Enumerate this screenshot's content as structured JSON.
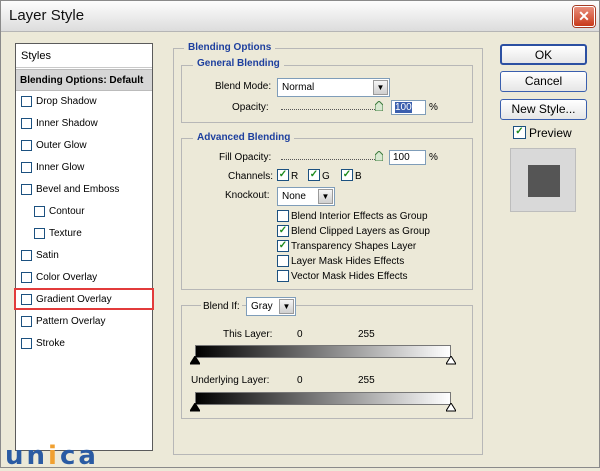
{
  "window": {
    "title": "Layer Style",
    "close_glyph": "✕"
  },
  "styles_panel": {
    "header": "Styles",
    "items": [
      {
        "label": "Blending Options: Default",
        "selected": true,
        "checkbox": false
      },
      {
        "label": "Drop Shadow",
        "checked": false
      },
      {
        "label": "Inner Shadow",
        "checked": false
      },
      {
        "label": "Outer Glow",
        "checked": false
      },
      {
        "label": "Inner Glow",
        "checked": false
      },
      {
        "label": "Bevel and Emboss",
        "checked": false
      },
      {
        "label": "Contour",
        "checked": false,
        "indent": true
      },
      {
        "label": "Texture",
        "checked": false,
        "indent": true
      },
      {
        "label": "Satin",
        "checked": false
      },
      {
        "label": "Color Overlay",
        "checked": false
      },
      {
        "label": "Gradient Overlay",
        "checked": false,
        "highlighted": true
      },
      {
        "label": "Pattern Overlay",
        "checked": false
      },
      {
        "label": "Stroke",
        "checked": false
      }
    ]
  },
  "blending_options": {
    "title": "Blending Options",
    "general": {
      "title": "General Blending",
      "blend_mode_label": "Blend Mode:",
      "blend_mode_value": "Normal",
      "opacity_label": "Opacity:",
      "opacity_value": "100",
      "opacity_unit": "%"
    },
    "advanced": {
      "title": "Advanced Blending",
      "fill_opacity_label": "Fill Opacity:",
      "fill_opacity_value": "100",
      "fill_opacity_unit": "%",
      "channels_label": "Channels:",
      "channels": [
        {
          "label": "R",
          "checked": true
        },
        {
          "label": "G",
          "checked": true
        },
        {
          "label": "B",
          "checked": true
        }
      ],
      "knockout_label": "Knockout:",
      "knockout_value": "None",
      "options": [
        {
          "label": "Blend Interior Effects as Group",
          "checked": false
        },
        {
          "label": "Blend Clipped Layers as Group",
          "checked": true
        },
        {
          "label": "Transparency Shapes Layer",
          "checked": true
        },
        {
          "label": "Layer Mask Hides Effects",
          "checked": false
        },
        {
          "label": "Vector Mask Hides Effects",
          "checked": false
        }
      ]
    },
    "blend_if": {
      "label": "Blend If:",
      "value": "Gray",
      "this_layer_label": "This Layer:",
      "this_layer_min": "0",
      "this_layer_max": "255",
      "underlying_label": "Underlying Layer:",
      "underlying_min": "0",
      "underlying_max": "255"
    }
  },
  "buttons": {
    "ok": "OK",
    "cancel": "Cancel",
    "new_style": "New Style..."
  },
  "preview": {
    "label": "Preview",
    "checked": true
  },
  "watermark": {
    "text_u": "un",
    "text_i": "i",
    "text_ca": "ca"
  },
  "colors": {
    "accent": "#1d3f9e",
    "highlight": "#e23b3b",
    "check": "#1d8a1d"
  }
}
